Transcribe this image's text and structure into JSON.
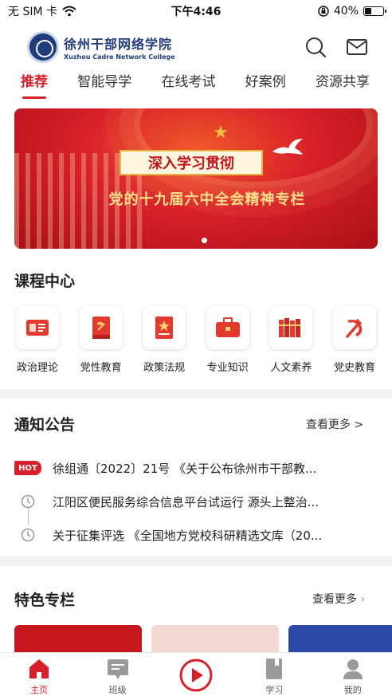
{
  "status_bar": {
    "carrier": "无 SIM 卡",
    "time": "下午4:46",
    "battery_percent": "40%",
    "battery_level": 0.4
  },
  "header": {
    "logo_cn": "徐州干部网络学院",
    "logo_en": "Xuzhou Cadre Network College",
    "icons": [
      "search-icon",
      "mail-icon"
    ]
  },
  "tabs": [
    {
      "label": "推荐",
      "active": true
    },
    {
      "label": "智能导学",
      "active": false
    },
    {
      "label": "在线考试",
      "active": false
    },
    {
      "label": "好案例",
      "active": false
    },
    {
      "label": "资源共享",
      "active": false
    }
  ],
  "banner": {
    "title": "深入学习贯彻",
    "subtitle": "党的十九届六中全会精神专栏",
    "slide_count": 1,
    "current_slide": 1
  },
  "course_center": {
    "title": "课程中心",
    "items": [
      {
        "label": "政治理论",
        "icon": "id-card-icon"
      },
      {
        "label": "党性教育",
        "icon": "party-book-icon"
      },
      {
        "label": "政策法规",
        "icon": "star-document-icon"
      },
      {
        "label": "专业知识",
        "icon": "briefcase-icon"
      },
      {
        "label": "人文素养",
        "icon": "books-icon"
      },
      {
        "label": "党史教育",
        "icon": "hammer-sickle-icon"
      }
    ]
  },
  "notices": {
    "title": "通知公告",
    "more": "查看更多 >",
    "items": [
      {
        "badge": "HOT",
        "text": "徐组通〔2022〕21号 《关于公布徐州市干部教..."
      },
      {
        "badge": "",
        "text": "江阳区便民服务综合信息平台试运行 源头上整治..."
      },
      {
        "badge": "",
        "text": "关于征集评选 《全国地方党校科研精选文库（20..."
      }
    ]
  },
  "features": {
    "title": "特色专栏",
    "more": "查看更多",
    "colors": [
      "#c8161e",
      "#f3d9d4",
      "#2b4aa8"
    ]
  },
  "bottom_nav": [
    {
      "label": "主页",
      "icon": "home-icon",
      "active": true
    },
    {
      "label": "班级",
      "icon": "class-icon",
      "active": false
    },
    {
      "label": "",
      "icon": "play-icon",
      "active": false
    },
    {
      "label": "学习",
      "icon": "study-book-icon",
      "active": false
    },
    {
      "label": "我的",
      "icon": "profile-icon",
      "active": false
    }
  ],
  "colors": {
    "accent": "#d8202a",
    "brand": "#1e3d7a"
  }
}
